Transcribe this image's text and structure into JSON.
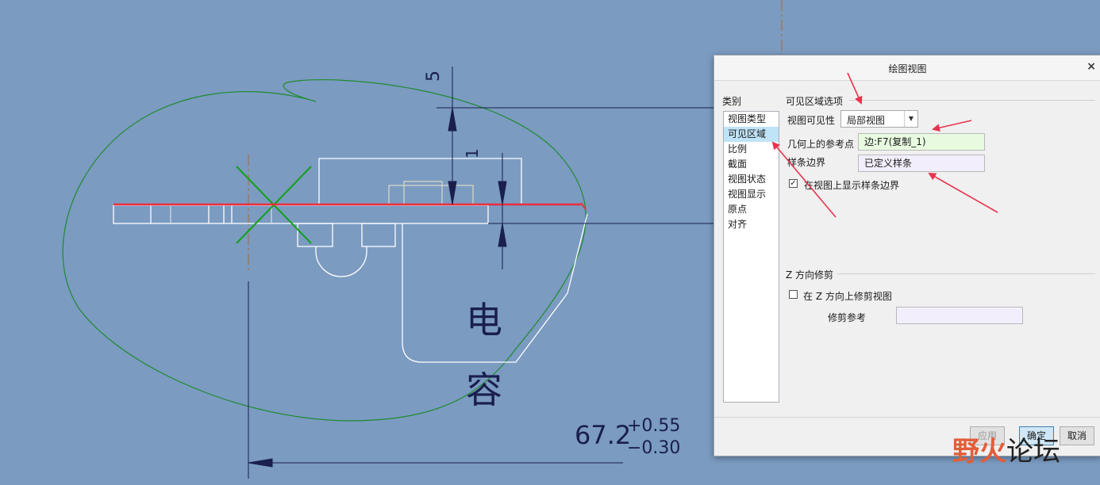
{
  "drawing": {
    "dimension_vertical": "5",
    "dimension_small": "1",
    "component_label": "电容",
    "dimension_main": "67.2",
    "tolerance_upper": "+0.55",
    "tolerance_lower": "−0.30"
  },
  "dialog": {
    "title": "绘图视图",
    "close": "×",
    "category_label": "类别",
    "categories": [
      {
        "label": "视图类型"
      },
      {
        "label": "可见区域",
        "selected": true
      },
      {
        "label": "比例"
      },
      {
        "label": "截面"
      },
      {
        "label": "视图状态"
      },
      {
        "label": "视图显示"
      },
      {
        "label": "原点"
      },
      {
        "label": "对齐"
      }
    ],
    "visible_area_section": "可见区域选项",
    "visibility_label": "视图可见性",
    "visibility_value": "局部视图",
    "ref_point_label": "几何上的参考点",
    "ref_point_value": "边:F7(复制_1)",
    "spline_label": "样条边界",
    "spline_value": "已定义样条",
    "show_spline_label": "在视图上显示样条边界",
    "show_spline_checked": true,
    "z_section": "Z 方向修剪",
    "z_trim_label": "在 Z 方向上修剪视图",
    "z_trim_checked": false,
    "trim_ref_label": "修剪参考",
    "trim_ref_value": "",
    "buttons": {
      "apply": "应用",
      "ok": "确定",
      "cancel": "取消"
    }
  },
  "watermark": {
    "part1": "野火",
    "part2": "论坛"
  },
  "colors": {
    "background": "#7b9bc1",
    "selection": "#bfe3f7",
    "ref_field": "#e8fbe0",
    "spline_field": "#f2eefb",
    "annotation_arrow": "#e8344f",
    "sketch_green": "#1f8a2e",
    "axis_red": "#ee2d3b"
  }
}
